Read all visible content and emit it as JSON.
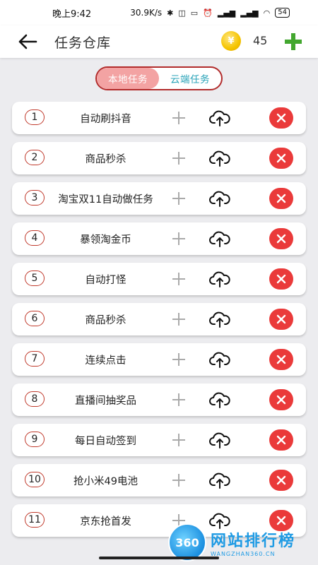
{
  "status_bar": {
    "time": "晚上9:42",
    "speed": "30.9K/s",
    "battery": "54"
  },
  "app_bar": {
    "title": "任务仓库",
    "coin_symbol": "¥",
    "coin_count": "45"
  },
  "tabs": [
    {
      "label": "本地任务",
      "active": true
    },
    {
      "label": "云端任务",
      "active": false
    }
  ],
  "tasks": [
    {
      "index": "1",
      "name": "自动刷抖音"
    },
    {
      "index": "2",
      "name": "商品秒杀"
    },
    {
      "index": "3",
      "name": "淘宝双11自动做任务"
    },
    {
      "index": "4",
      "name": "暴领淘金币"
    },
    {
      "index": "5",
      "name": "自动打怪"
    },
    {
      "index": "6",
      "name": "商品秒杀"
    },
    {
      "index": "7",
      "name": "连续点击"
    },
    {
      "index": "8",
      "name": "直播间抽奖品"
    },
    {
      "index": "9",
      "name": "每日自动签到"
    },
    {
      "index": "10",
      "name": "抢小米49电池"
    },
    {
      "index": "11",
      "name": "京东抢首发"
    }
  ],
  "watermark": {
    "logo": "360",
    "name": "网站排行榜",
    "url": "WANGZHAN360.CN"
  },
  "colors": {
    "accent_red": "#ea3a3a",
    "tab_active_bg": "#f3a3a3",
    "tab_inactive_text": "#29a3b8",
    "add_green": "#43a72f"
  },
  "icons": {
    "back": "arrow-left-icon",
    "coin": "coin-icon",
    "add": "plus-icon",
    "upload": "cloud-upload-icon",
    "delete": "close-icon"
  }
}
